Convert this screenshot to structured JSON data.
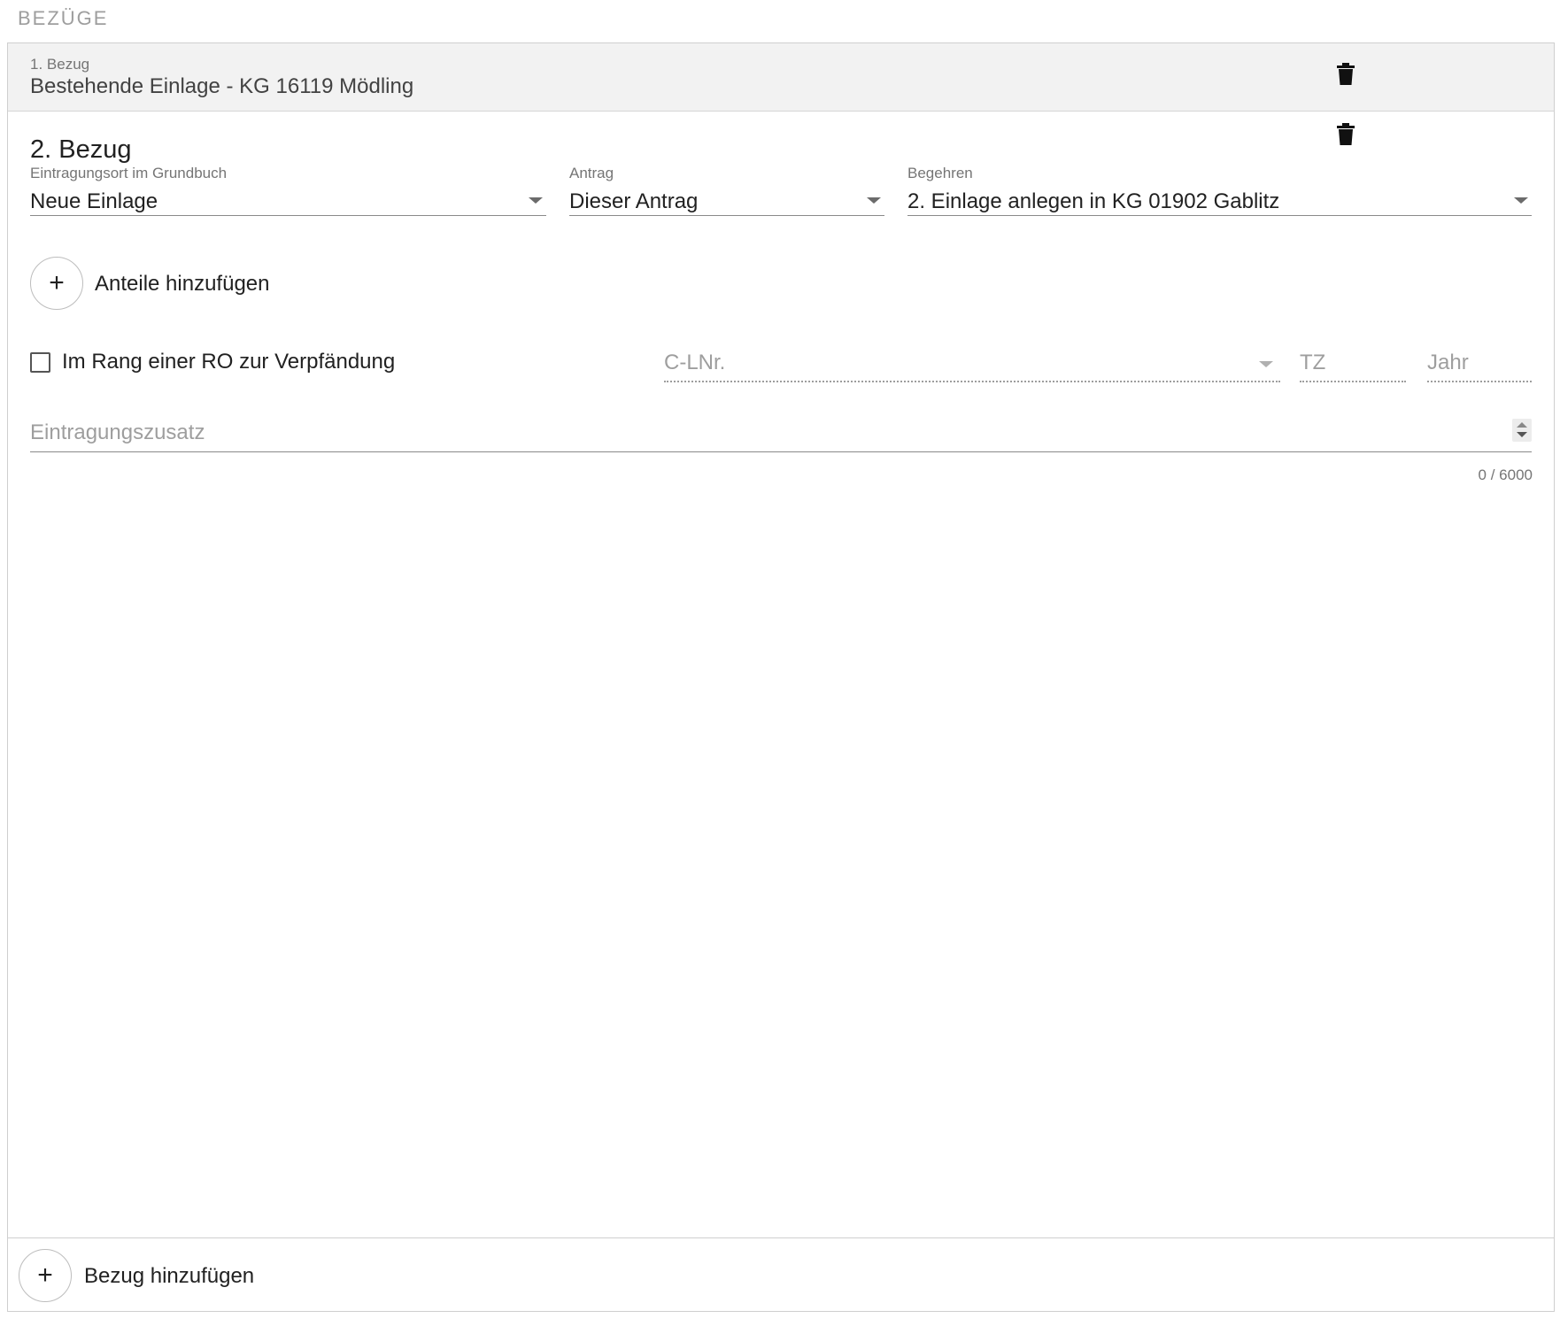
{
  "header": {
    "title": "BEZÜGE"
  },
  "bezug1": {
    "label": "1. Bezug",
    "value": "Bestehende Einlage - KG 16119 Mödling",
    "delete_icon": "trash-icon"
  },
  "bezug2": {
    "title": "2. Bezug",
    "delete_icon": "trash-icon",
    "eintragungsort": {
      "label": "Eintragungsort im Grundbuch",
      "value": "Neue Einlage"
    },
    "antrag": {
      "label": "Antrag",
      "value": "Dieser Antrag"
    },
    "begehren": {
      "label": "Begehren",
      "value": "2. Einlage anlegen in KG 01902 Gablitz"
    },
    "add_anteile": {
      "icon": "+",
      "label": "Anteile hinzufügen"
    },
    "rang_checkbox": {
      "label": "Im Rang einer RO zur Verpfändung",
      "checked": false
    },
    "clnr": {
      "placeholder": "C-LNr."
    },
    "tz": {
      "placeholder": "TZ"
    },
    "jahr": {
      "placeholder": "Jahr"
    },
    "eintragungszusatz": {
      "placeholder": "Eintragungszusatz",
      "counter": "0 / 6000"
    }
  },
  "footer": {
    "add_bezug": {
      "icon": "+",
      "label": "Bezug hinzufügen"
    }
  }
}
